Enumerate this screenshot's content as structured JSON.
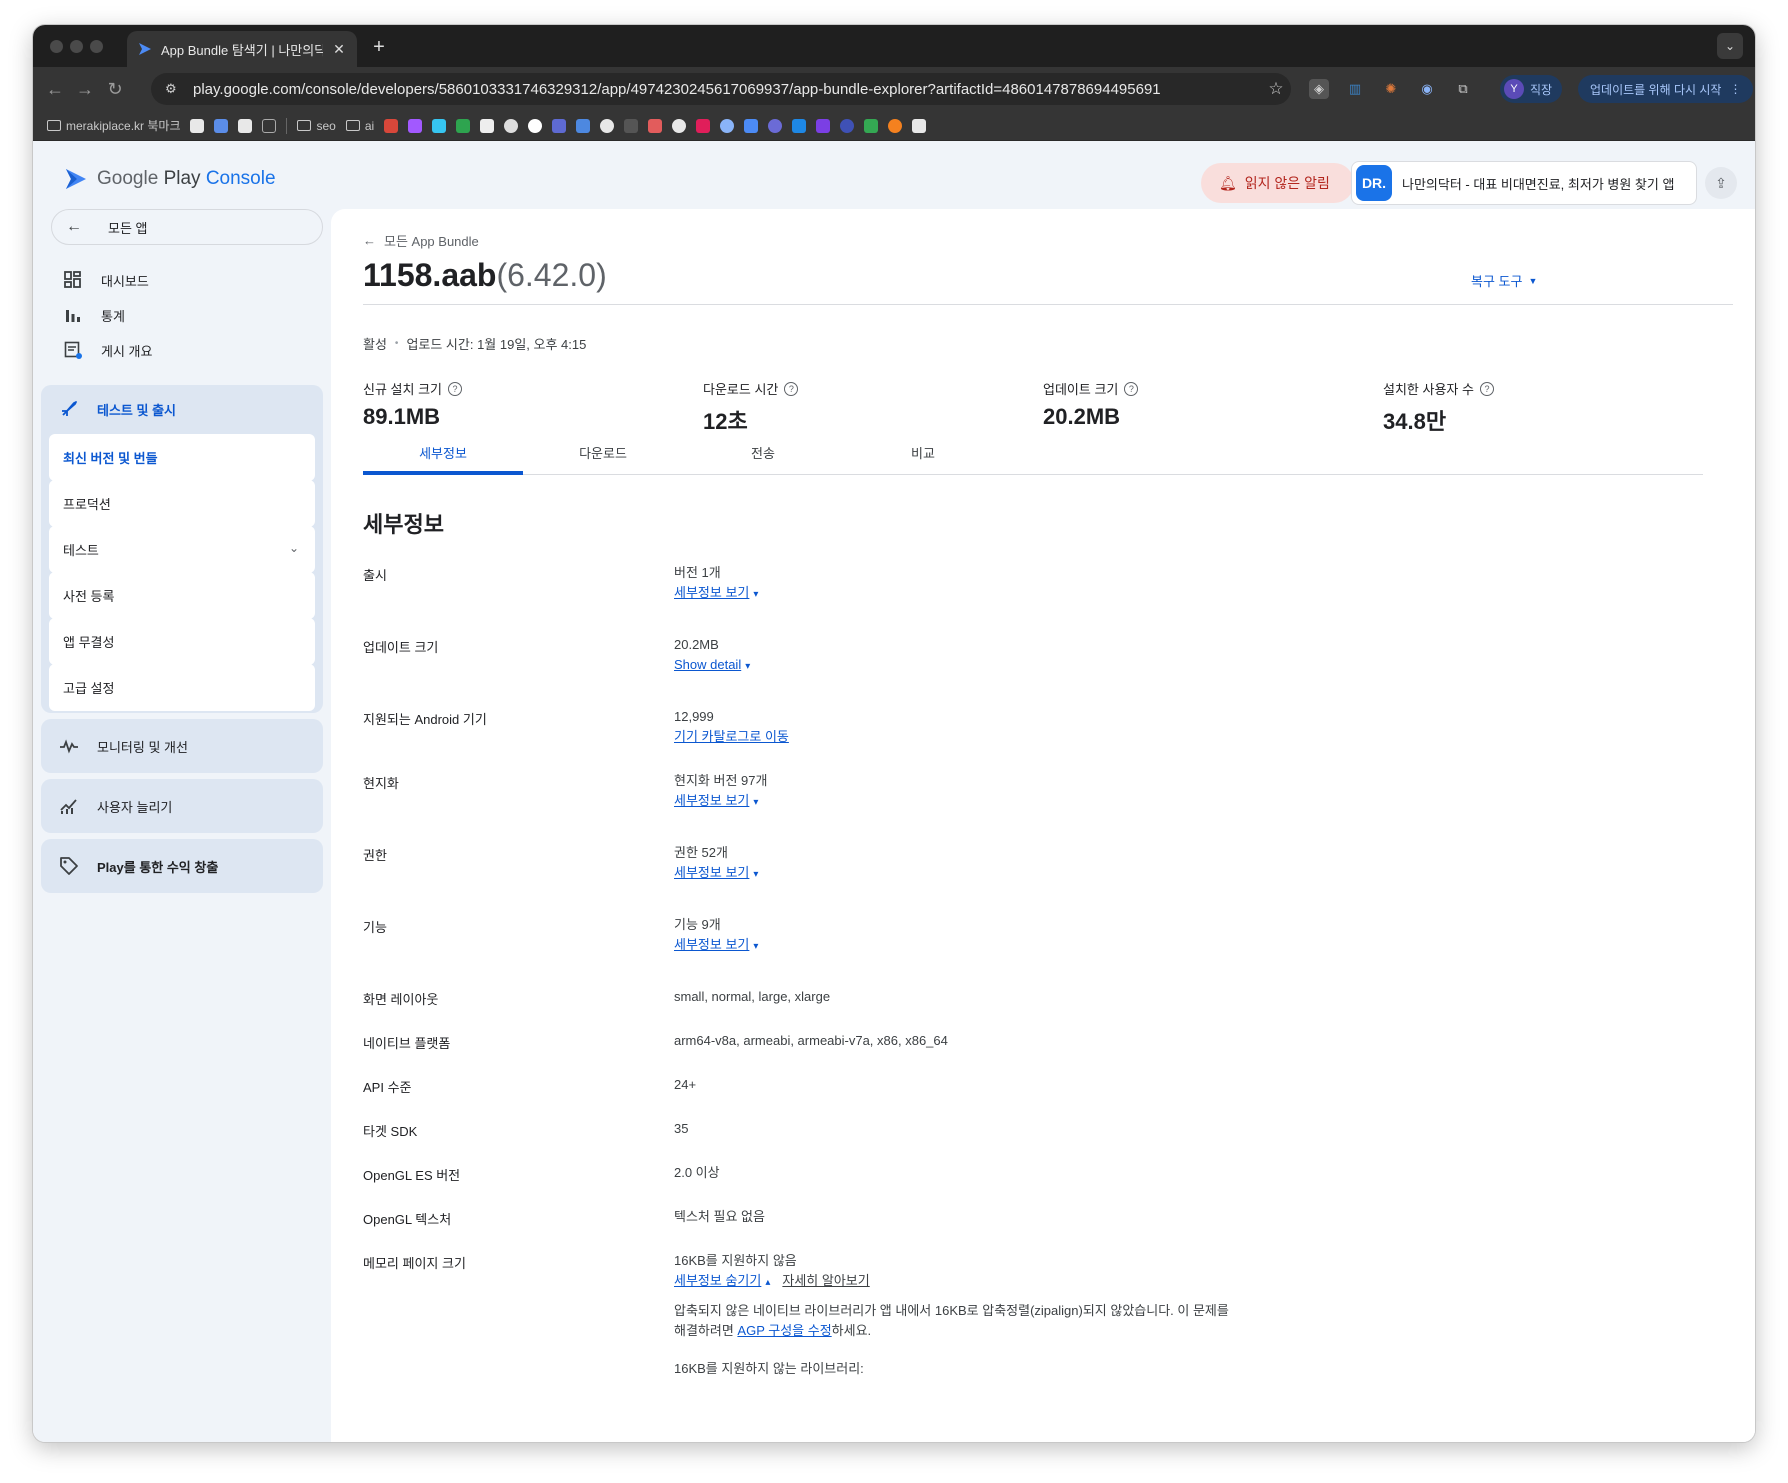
{
  "browser": {
    "tab_title": "App Bundle 탐색기 | 나만의닥터",
    "url": "play.google.com/console/developers/5860103331746329312/app/4974230245617069937/app-bundle-explorer?artifactId=4860147878694495691",
    "profile_label": "직장",
    "profile_initial": "Y",
    "update_button": "업데이트를 위해 다시 시작",
    "bookmarks": [
      {
        "label": "merakiplace.kr 북마크",
        "type": "folder"
      },
      {
        "label": "seo",
        "type": "folder"
      },
      {
        "label": "ai",
        "type": "folder"
      }
    ]
  },
  "header": {
    "logo_google": "Google",
    "logo_play": "Play",
    "logo_console": "Console",
    "alert_label": "읽지 않은 알림",
    "app_icon_text": "DR.",
    "app_name": "나만의닥터 - 대표 비대면진료, 최저가 병원 찾기 앱"
  },
  "sidebar": {
    "back_label": "모든 앱",
    "items": [
      {
        "label": "대시보드",
        "icon": "dashboard-icon"
      },
      {
        "label": "통계",
        "icon": "bar-chart-icon"
      },
      {
        "label": "게시 개요",
        "icon": "publishing-overview-icon"
      }
    ],
    "test_release": {
      "label": "테스트 및 출시",
      "sub_items": [
        {
          "label": "최신 버전 및 번들",
          "active": true
        },
        {
          "label": "프로덕션"
        },
        {
          "label": "테스트",
          "expandable": true
        },
        {
          "label": "사전 등록"
        },
        {
          "label": "앱 무결성"
        },
        {
          "label": "고급 설정"
        }
      ]
    },
    "groups": [
      {
        "label": "모니터링 및 개선",
        "icon": "pulse-icon"
      },
      {
        "label": "사용자 늘리기",
        "icon": "growth-icon"
      },
      {
        "label": "Play를 통한 수익 창출",
        "icon": "tag-icon"
      }
    ]
  },
  "main": {
    "breadcrumb": "모든 App Bundle",
    "title": "1158.aab",
    "title_version": "(6.42.0)",
    "recover_tools": "복구 도구",
    "status": "활성",
    "upload_time": "업로드 시간: 1월 19일, 오후 4:15",
    "metrics": [
      {
        "label": "신규 설치 크기",
        "value": "89.1MB"
      },
      {
        "label": "다운로드 시간",
        "value": "12초"
      },
      {
        "label": "업데이트 크기",
        "value": "20.2MB"
      },
      {
        "label": "설치한 사용자 수",
        "value": "34.8만"
      }
    ],
    "tabs": [
      "세부정보",
      "다운로드",
      "전송",
      "비교"
    ],
    "active_tab": "세부정보",
    "section_title": "세부정보",
    "details": [
      {
        "label": "출시",
        "value": "버전 1개",
        "link": "세부정보 보기"
      },
      {
        "label": "업데이트 크기",
        "value": "20.2MB",
        "link": "Show detail"
      },
      {
        "label": "지원되는 Android 기기",
        "value": "12,999",
        "link": "기기 카탈로그로 이동"
      },
      {
        "label": "현지화",
        "value": "현지화 버전 97개",
        "link": "세부정보 보기"
      },
      {
        "label": "권한",
        "value": "권한 52개",
        "link": "세부정보 보기"
      },
      {
        "label": "기능",
        "value": "기능 9개",
        "link": "세부정보 보기"
      },
      {
        "label": "화면 레이아웃",
        "value": "small, normal, large, xlarge"
      },
      {
        "label": "네이티브 플랫폼",
        "value": "arm64-v8a, armeabi, armeabi-v7a, x86, x86_64"
      },
      {
        "label": "API 수준",
        "value": "24+"
      },
      {
        "label": "타겟 SDK",
        "value": "35"
      },
      {
        "label": "OpenGL ES 버전",
        "value": "2.0 이상"
      },
      {
        "label": "OpenGL 텍스처",
        "value": "텍스처 필요 없음"
      }
    ],
    "memory": {
      "label": "메모리 페이지 크기",
      "value": "16KB를 지원하지 않음",
      "hide_link": "세부정보 숨기기",
      "learn_more": "자세히 알아보기",
      "desc_line1": "압축되지 않은 네이티브 라이브러리가 앱 내에서 16KB로 압축정렬(zipalign)되지 않았습니다. 이 문제를",
      "desc_line2_pre": "해결하려면 ",
      "desc_link": "AGP 구성을 수정",
      "desc_line2_post": "하세요.",
      "libs_heading": "16KB를 지원하지 않는 라이브러리:"
    }
  }
}
